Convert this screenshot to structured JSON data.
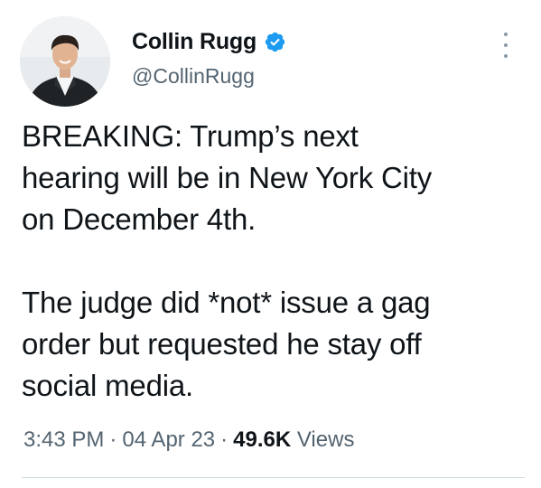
{
  "author": {
    "display_name": "Collin Rugg",
    "handle": "@CollinRugg",
    "verified_color": "#1d9bf0",
    "avatar_icon": "profile-photo"
  },
  "menu": {
    "icon": "more-options-icon"
  },
  "tweet": {
    "paragraph_1": "BREAKING: Trump’s next\nhearing will be in New York City\non December 4th.",
    "paragraph_2": "The judge did *not* issue a gag\norder but requested he stay off\nsocial media."
  },
  "meta": {
    "time": "3:43 PM",
    "separator": "·",
    "date": "04 Apr 23",
    "views_count": "49.6K",
    "views_label": "Views"
  },
  "colors": {
    "text": "#0f1419",
    "secondary": "#536471",
    "divider": "#cfd9de"
  }
}
